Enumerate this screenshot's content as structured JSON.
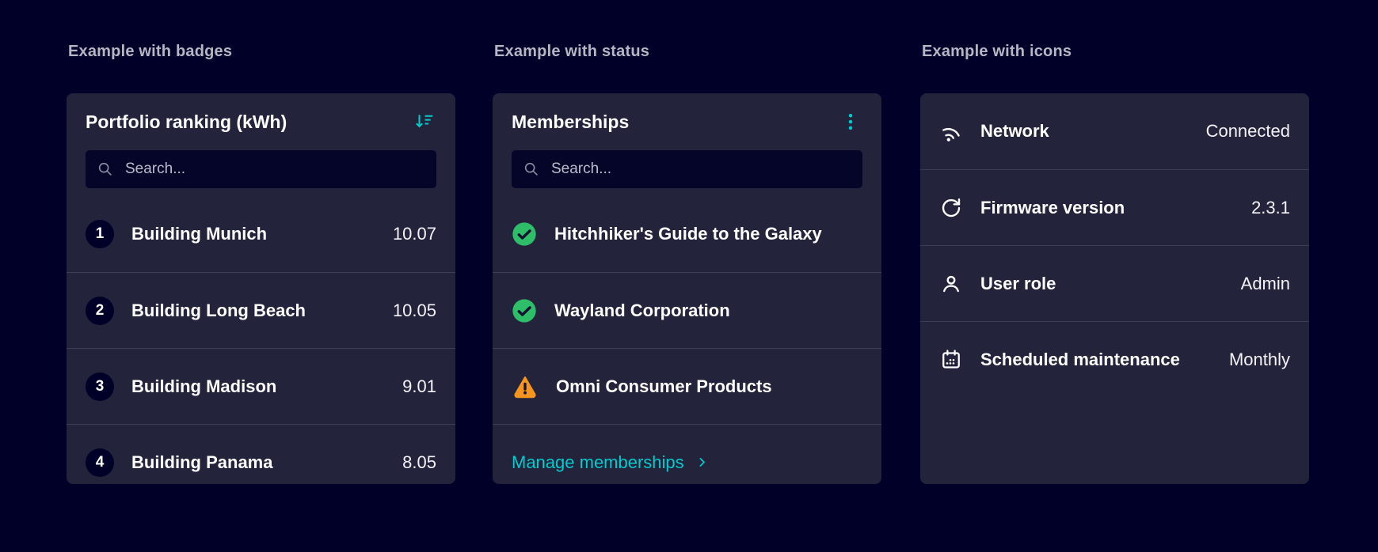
{
  "badges_section": {
    "heading": "Example with badges",
    "card_title": "Portfolio ranking (kWh)",
    "header_icon": "sort-descending-icon",
    "search_placeholder": "Search...",
    "items": [
      {
        "rank": "1",
        "name": "Building Munich",
        "value": "10.07"
      },
      {
        "rank": "2",
        "name": "Building Long Beach",
        "value": "10.05"
      },
      {
        "rank": "3",
        "name": "Building Madison",
        "value": "9.01"
      },
      {
        "rank": "4",
        "name": "Building Panama",
        "value": "8.05"
      }
    ]
  },
  "status_section": {
    "heading": "Example with status",
    "card_title": "Memberships",
    "header_icon": "kebab-menu-icon",
    "search_placeholder": "Search...",
    "items": [
      {
        "status": "success",
        "icon": "check-circle-icon",
        "name": "Hitchhiker's Guide to the Galaxy"
      },
      {
        "status": "success",
        "icon": "check-circle-icon",
        "name": "Wayland Corporation"
      },
      {
        "status": "warning",
        "icon": "warning-triangle-icon",
        "name": "Omni Consumer Products"
      }
    ],
    "link_label": "Manage memberships",
    "link_icon": "chevron-right-icon"
  },
  "icons_section": {
    "heading": "Example with icons",
    "items": [
      {
        "icon": "network-icon",
        "label": "Network",
        "value": "Connected"
      },
      {
        "icon": "firmware-refresh-icon",
        "label": "Firmware version",
        "value": "2.3.1"
      },
      {
        "icon": "user-icon",
        "label": "User role",
        "value": "Admin"
      },
      {
        "icon": "calendar-icon",
        "label": "Scheduled maintenance",
        "value": "Monthly"
      }
    ]
  },
  "colors": {
    "page_bg": "#000028",
    "card_bg": "#23233C",
    "accent_teal": "#00CCCC",
    "success_green": "#2EBE6A",
    "warning_orange": "#F5941F",
    "heading_text": "#B6B6C4",
    "divider": "#3E3E55"
  }
}
